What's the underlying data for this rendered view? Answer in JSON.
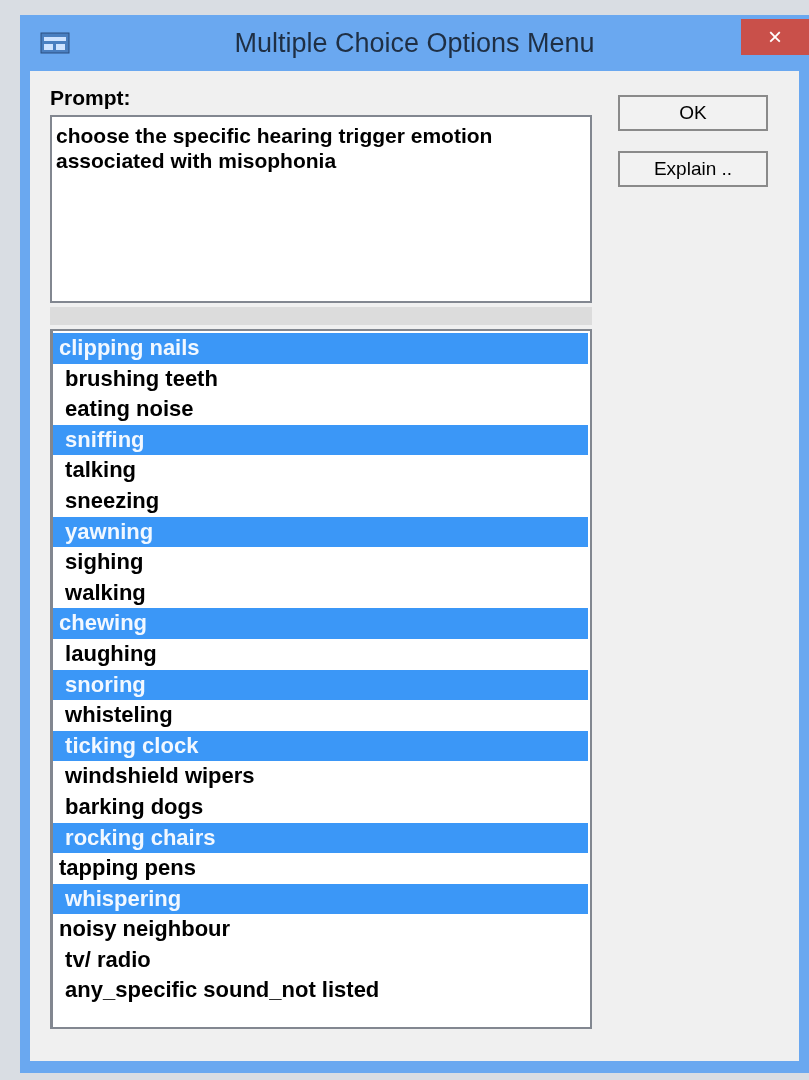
{
  "window": {
    "title": "Multiple Choice Options Menu",
    "close": "×"
  },
  "prompt": {
    "label": "Prompt:",
    "value": "choose the specific hearing trigger emotion associated with misophonia"
  },
  "buttons": [
    "OK",
    "Explain .."
  ],
  "options": [
    {
      "label": "clipping nails",
      "selected": true
    },
    {
      "label": " brushing teeth",
      "selected": false
    },
    {
      "label": " eating noise",
      "selected": false
    },
    {
      "label": " sniffing",
      "selected": true
    },
    {
      "label": " talking",
      "selected": false
    },
    {
      "label": " sneezing",
      "selected": false
    },
    {
      "label": " yawning",
      "selected": true
    },
    {
      "label": " sighing",
      "selected": false
    },
    {
      "label": " walking",
      "selected": false
    },
    {
      "label": "chewing",
      "selected": true
    },
    {
      "label": " laughing",
      "selected": false
    },
    {
      "label": " snoring",
      "selected": true
    },
    {
      "label": " whisteling",
      "selected": false
    },
    {
      "label": " ticking clock",
      "selected": true
    },
    {
      "label": " windshield wipers",
      "selected": false
    },
    {
      "label": " barking dogs",
      "selected": false
    },
    {
      "label": " rocking chairs",
      "selected": true
    },
    {
      "label": "tapping pens",
      "selected": false
    },
    {
      "label": " whispering",
      "selected": true
    },
    {
      "label": "noisy neighbour",
      "selected": false
    },
    {
      "label": " tv/ radio",
      "selected": false
    },
    {
      "label": " any_specific sound_not listed",
      "selected": false
    }
  ]
}
